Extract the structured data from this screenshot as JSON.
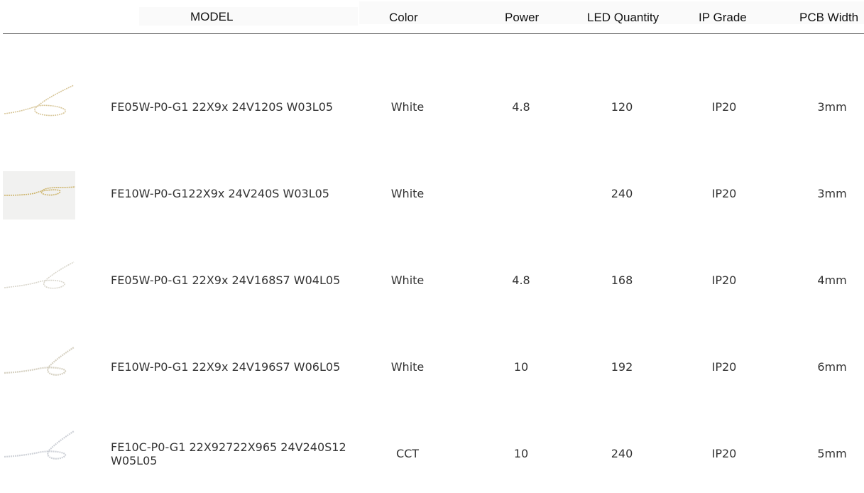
{
  "headers": {
    "model": "MODEL",
    "color": "Color",
    "power": "Power",
    "led_quantity": "LED Quantity",
    "ip_grade": "IP Grade",
    "pcb_width": "PCB Width"
  },
  "rows": [
    {
      "model": "FE05W-P0-G1 22X9x 24V120S W03L05",
      "color": "White",
      "power": "4.8",
      "led_quantity": "120",
      "ip_grade": "IP20",
      "pcb_width": "3mm",
      "thumb": "led-strip-thumbnail"
    },
    {
      "model": "FE10W-P0-G122X9x 24V240S W03L05",
      "color": "White",
      "power": "",
      "led_quantity": "240",
      "ip_grade": "IP20",
      "pcb_width": "3mm",
      "thumb": "led-strip-thumbnail"
    },
    {
      "model": "FE05W-P0-G1 22X9x 24V168S7 W04L05",
      "color": "White",
      "power": "4.8",
      "led_quantity": "168",
      "ip_grade": "IP20",
      "pcb_width": "4mm",
      "thumb": "led-strip-thumbnail"
    },
    {
      "model": "FE10W-P0-G1 22X9x 24V196S7 W06L05",
      "color": "White",
      "power": "10",
      "led_quantity": "192",
      "ip_grade": "IP20",
      "pcb_width": "6mm",
      "thumb": "led-strip-thumbnail"
    },
    {
      "model": "FE10C-P0-G1 22X92722X965 24V240S12 W05L05",
      "color": "CCT",
      "power": "10",
      "led_quantity": "240",
      "ip_grade": "IP20",
      "pcb_width": "5mm",
      "thumb": "led-strip-thumbnail"
    }
  ]
}
